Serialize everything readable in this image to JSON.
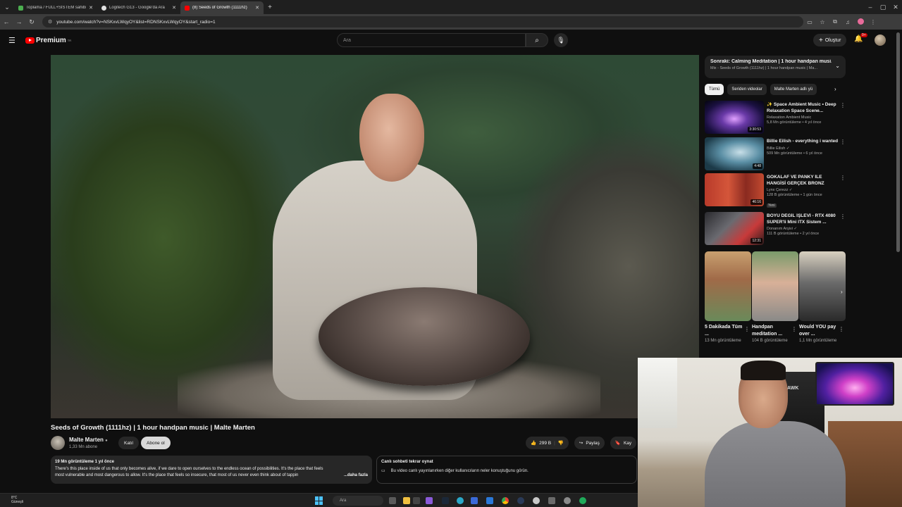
{
  "browser": {
    "tabs": [
      {
        "title": "Toplama / FULL+SİSTEM sahibi",
        "fav_color": "#4caf50",
        "active": false
      },
      {
        "title": "Logitech G13 - Google'da Ara",
        "fav_color": "#e0e0e0",
        "active": false
      },
      {
        "title": "(8) Seeds of Growth (1111hz)",
        "fav_color": "#ff0000",
        "active": true
      }
    ],
    "new_tab": "+",
    "url": "youtube.com/watch?v=NSKxvLWqyOY&list=RDNSKxvLWqyOY&start_radio=1"
  },
  "youtube": {
    "logo_text": "Premium",
    "logo_sup": "TR",
    "search_placeholder": "Ara",
    "create_label": "Oluştur",
    "notifications_count": "9+"
  },
  "video": {
    "title": "Seeds of Growth (1111hz) | 1 hour handpan music | Malte Marten",
    "channel": "Malte Marten",
    "subscribers": "1,33 Mn abone",
    "join_label": "Katıl",
    "subscribe_label": "Abone ol",
    "likes": "299 B",
    "share_label": "Paylaş",
    "save_label": "Kay",
    "views_meta": "19 Mn görüntüleme  1 yıl önce",
    "description_line1": "There's this place inside of us that only becomes alive, if we dare to open ourselves to the endless ocean of possibilities. It's the place that feels",
    "description_line2": "most vulnerable and most dangerous to allow. It's the place that feels so insecure, that most of us never even think about of tappin",
    "more_label": "...daha fazla"
  },
  "live_chat": {
    "title": "Canlı sohbeti tekrar oynat",
    "text": "Bu video canlı yayınlanırken diğer kullanıcıların neler konuştuğunu görün."
  },
  "sidebar": {
    "next_up_title": "Sonraki: Calming Meditation | 1 hour handpan musi...",
    "next_up_sub": "Mix - Seeds of Growth (1111hz) | 1 hour handpan music | Ma...",
    "chips": [
      "Tümü",
      "Seriden videolar",
      "Malte Marten adlı yü"
    ],
    "recommendations": [
      {
        "title": "✨ Space Ambient Music • Deep Relaxation Space Scene...",
        "channel": "Relaxation Ambient Music",
        "meta": "5,8 Mn görüntüleme • 4 yıl önce",
        "duration": "3:30:53",
        "thumb": "space"
      },
      {
        "title": "Billie Eilish - everything i wanted",
        "channel": "Billie Eilish ✓",
        "meta": "509 Mn görüntüleme • 6 yıl önce",
        "duration": "4:48",
        "thumb": "billie"
      },
      {
        "title": "GOKALAF VE PANKY İLE HANGİSİ GERÇEK BRONZ",
        "channel": "Lynx Çerezz ✓",
        "meta": "128 B görüntüleme • 1 gün önce",
        "duration": "46:16",
        "badge": "Yeni",
        "thumb": "bronz"
      },
      {
        "title": "BOYU DEĞİL İŞLEVİ - RTX 4080 SUPER'li Mini ITX Sistem ...",
        "channel": "Donanım Arşivi ✓",
        "meta": "111 B görüntüleme • 2 yıl önce",
        "duration": "12:31",
        "thumb": "pc"
      }
    ],
    "shorts": [
      {
        "title": "5 Dakikada Tüm ...",
        "views": "13 Mn görüntüleme"
      },
      {
        "title": "Handpan meditation ...",
        "views": "104 B görüntüleme"
      },
      {
        "title": "Would YOU pay over ...",
        "views": "1,1 Mn görüntüleme"
      }
    ]
  },
  "webcam": {
    "chair_label": "HAWK"
  },
  "taskbar": {
    "weather_temp": "8°C",
    "weather_text": "Güneşli",
    "search_placeholder": "Ara"
  }
}
